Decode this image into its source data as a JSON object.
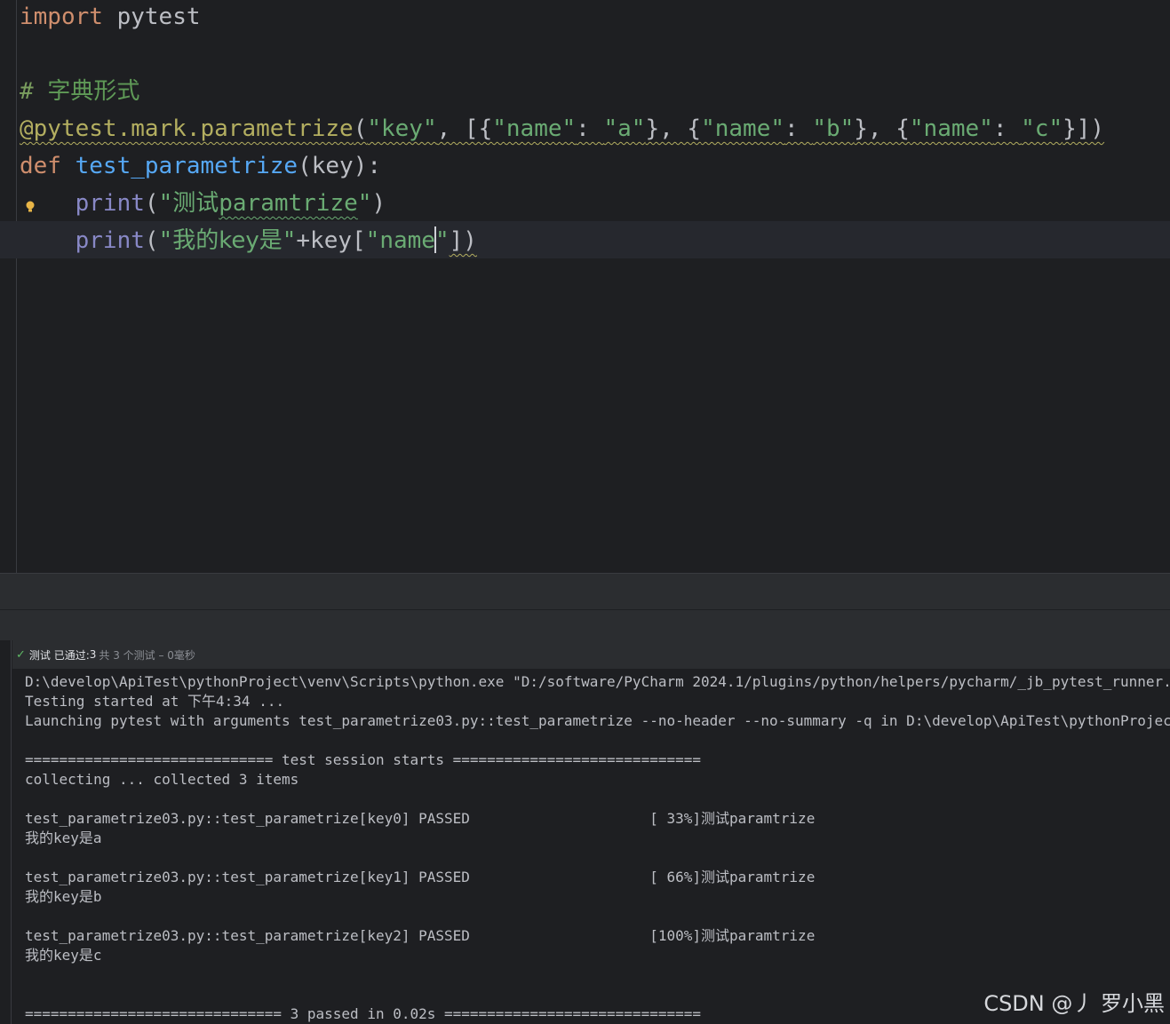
{
  "editor": {
    "line1": {
      "kw": "import",
      "rest": " pytest"
    },
    "line3": {
      "hash": "# ",
      "comment": "字典形式"
    },
    "line4": {
      "decorator": "@pytest.mark.parametrize",
      "open": "(",
      "s_key": "\"key\"",
      "comma1": ", [{",
      "s_name1": "\"name\"",
      "colon1": ": ",
      "s_a": "\"a\"",
      "sep1": "}, {",
      "s_name2": "\"name\"",
      "colon2": ": ",
      "s_b": "\"b\"",
      "sep2": "}, {",
      "s_name3": "\"name\"",
      "colon3": ": ",
      "s_c": "\"c\"",
      "close": "}])"
    },
    "line5": {
      "kw": "def",
      "space": " ",
      "fn": "test_parametrize",
      "rest": "(key):"
    },
    "line6": {
      "indent": "    ",
      "builtin": "print",
      "open": "(",
      "q1": "\"",
      "cn": "测试",
      "word": "paramtrize",
      "q2": "\"",
      "close": ")"
    },
    "line7": {
      "indent": "    ",
      "builtin": "print",
      "open": "(",
      "q1": "\"",
      "cn": "我的key是",
      "q2": "\"",
      "plus": "+key[",
      "s_name_a": "\"name",
      "s_name_b": "\"",
      "close": "])"
    }
  },
  "run_panel": {
    "status": {
      "label": "测试 已通过:",
      "count": "3",
      "detail": "共 3 个测试 – 0毫秒"
    },
    "console_lines": [
      "D:\\develop\\ApiTest\\pythonProject\\venv\\Scripts\\python.exe \"D:/software/PyCharm 2024.1/plugins/python/helpers/pycharm/_jb_pytest_runner.py\"",
      "Testing started at 下午4:34 ...",
      "Launching pytest with arguments test_parametrize03.py::test_parametrize --no-header --no-summary -q in D:\\develop\\ApiTest\\pythonProject",
      "",
      "============================= test session starts =============================",
      "collecting ... collected 3 items",
      "",
      "test_parametrize03.py::test_parametrize[key0] PASSED                     [ 33%]测试paramtrize",
      "我的key是a",
      "",
      "test_parametrize03.py::test_parametrize[key1] PASSED                     [ 66%]测试paramtrize",
      "我的key是b",
      "",
      "test_parametrize03.py::test_parametrize[key2] PASSED                     [100%]测试paramtrize",
      "我的key是c",
      "",
      "",
      "============================== 3 passed in 0.02s =============================="
    ]
  },
  "watermark": "CSDN @丿 罗小黑",
  "colors": {
    "background": "#1e1f22",
    "keyword": "#cf8e6d",
    "string": "#6aab73",
    "function": "#56a8f5",
    "decorator": "#b3ae60",
    "builtin": "#8888c6",
    "pass_check": "#5fb865"
  }
}
